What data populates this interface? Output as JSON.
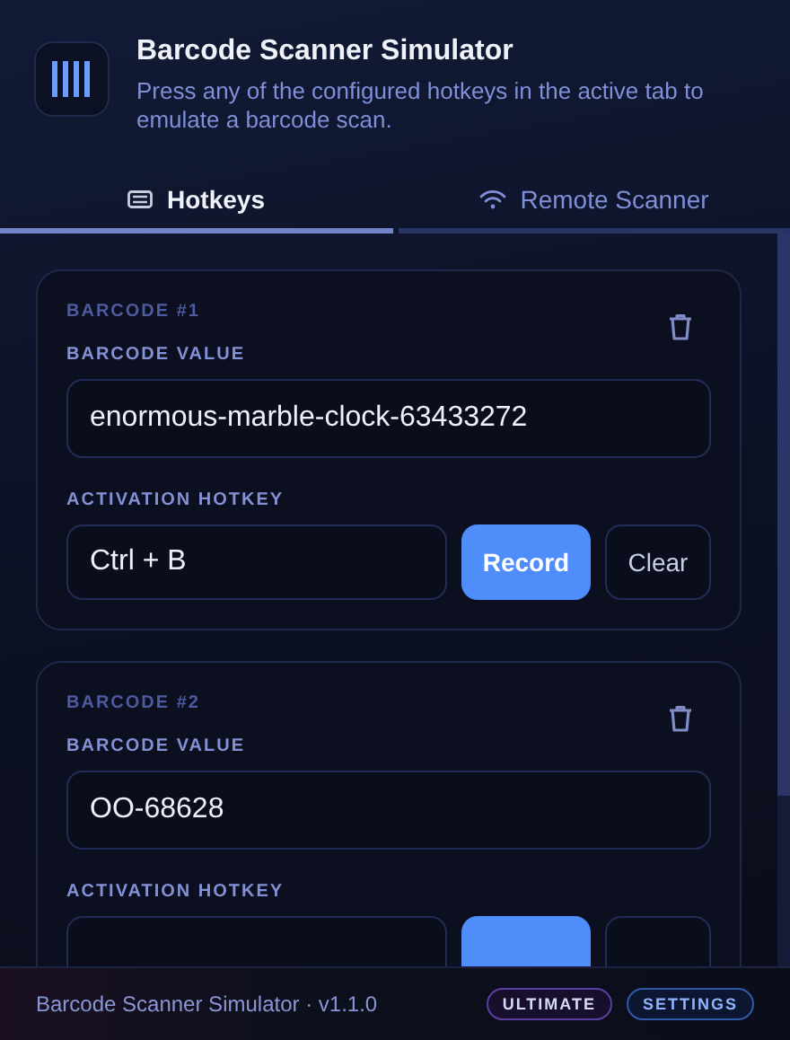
{
  "header": {
    "title": "Barcode Scanner Simulator",
    "subtitle": "Press any of the configured hotkeys in the active tab to emulate a barcode scan."
  },
  "tabs": [
    {
      "label": "Hotkeys",
      "kind": "keyboard",
      "selected": true
    },
    {
      "label": "Remote Scanner",
      "kind": "wifi",
      "selected": false
    }
  ],
  "barcodes": [
    {
      "heading": "BARCODE #1",
      "value_label": "BARCODE VALUE",
      "value": "enormous-marble-clock-63433272",
      "hotkey_label": "ACTIVATION HOTKEY",
      "hotkey": "Ctrl + B",
      "record_label": "Record",
      "clear_label": "Clear"
    },
    {
      "heading": "BARCODE #2",
      "value_label": "BARCODE VALUE",
      "value": "OO-68628",
      "hotkey_label": "ACTIVATION HOTKEY"
    }
  ],
  "footer": {
    "text": "Barcode Scanner Simulator · v1.1.0",
    "badges": [
      {
        "label": "ULTIMATE",
        "kind": "plan"
      },
      {
        "label": "SETTINGS",
        "kind": "link"
      }
    ]
  }
}
